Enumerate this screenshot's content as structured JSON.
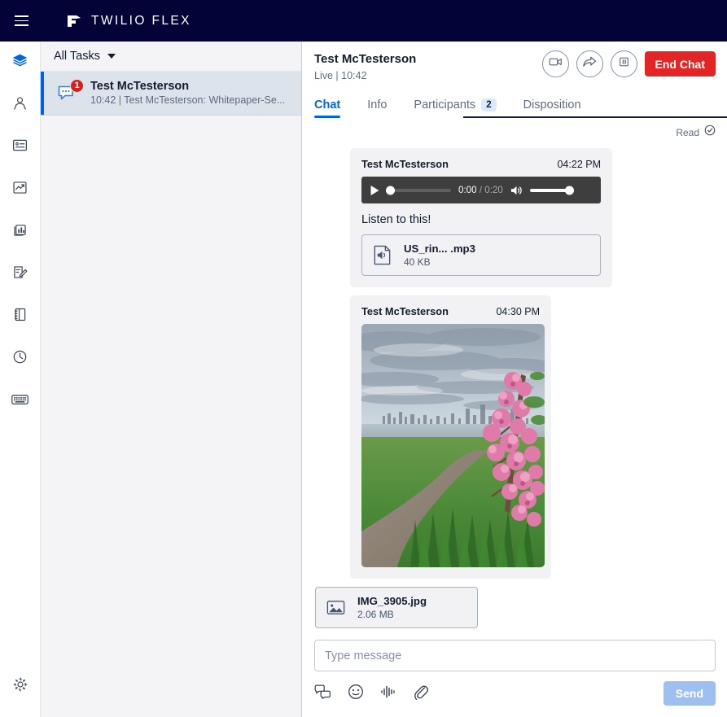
{
  "app": {
    "brand": "TWILIO FLEX",
    "menu_icon": "hamburger-icon",
    "logo_icon": "twilio-logo-icon"
  },
  "rail": {
    "items": [
      {
        "icon": "layers-icon",
        "name": "agent-desktop",
        "active": true
      },
      {
        "icon": "agents-icon",
        "name": "agents",
        "active": false
      },
      {
        "icon": "contact-list-icon",
        "name": "queues-stats",
        "active": false
      },
      {
        "icon": "trend-chart-icon",
        "name": "real-time-dashboard",
        "active": false
      },
      {
        "icon": "bar-chart-icon",
        "name": "insights-dashboards",
        "active": false
      },
      {
        "icon": "form-edit-icon",
        "name": "forms",
        "active": false
      },
      {
        "icon": "notebook-icon",
        "name": "directory",
        "active": false
      },
      {
        "icon": "clock-icon",
        "name": "history",
        "active": false
      },
      {
        "icon": "keyboard-icon",
        "name": "keyboard-shortcuts",
        "active": false
      }
    ],
    "settings_icon": "gear-icon"
  },
  "tasklist": {
    "filter_label": "All Tasks",
    "filter_caret_icon": "caret-down-icon",
    "tasks": [
      {
        "icon": "chat-bubble-icon",
        "badge": "1",
        "title": "Test McTesterson",
        "preview": "10:42 | Test McTesterson: Whitepaper-Se...",
        "selected": true
      }
    ]
  },
  "chat": {
    "contact_name": "Test McTesterson",
    "status": "Live | 10:42",
    "actions": [
      {
        "icon": "video-camera-icon",
        "name": "start-video-button"
      },
      {
        "icon": "forward-arrow-icon",
        "name": "transfer-task-button"
      },
      {
        "icon": "pause-icon",
        "name": "hold-task-button"
      }
    ],
    "end_chat_label": "End Chat",
    "tabs": [
      {
        "label": "Chat",
        "active": true,
        "badge": null
      },
      {
        "label": "Info",
        "active": false,
        "badge": null
      },
      {
        "label": "Participants",
        "active": false,
        "badge": "2"
      },
      {
        "label": "Disposition",
        "active": false,
        "badge": null
      }
    ],
    "read_receipt": {
      "label": "Read",
      "icon": "check-circle-icon"
    },
    "messages": [
      {
        "type": "audio",
        "author": "Test McTesterson",
        "time": "04:22 PM",
        "player": {
          "play_icon": "play-icon",
          "current_time": "0:00",
          "separator": "/",
          "duration": "0:20",
          "volume_icon": "volume-icon"
        },
        "text": "Listen to this!",
        "attachment": {
          "icon": "audio-file-icon",
          "name": "US_rin...  .mp3",
          "size": "40 KB"
        }
      },
      {
        "type": "image",
        "author": "Test McTesterson",
        "time": "04:30 PM",
        "attachment": {
          "icon": "image-file-icon",
          "name": "IMG_3905.jpg",
          "size": "2.06 MB"
        }
      }
    ],
    "composer": {
      "placeholder": "Type message",
      "value": "",
      "tools": [
        {
          "icon": "quick-responses-icon",
          "name": "quick-responses-button"
        },
        {
          "icon": "emoji-icon",
          "name": "emoji-picker-button"
        },
        {
          "icon": "audio-waveform-icon",
          "name": "record-audio-button"
        },
        {
          "icon": "paperclip-icon",
          "name": "attach-file-button"
        }
      ],
      "send_label": "Send"
    }
  },
  "colors": {
    "brand_navy": "#030337",
    "accent_blue": "#0263e0",
    "danger_red": "#e22525",
    "badge_red": "#d61f1f",
    "selected_task_bg": "#dde3ea",
    "bubble_bg": "#f2f2f5",
    "player_bg": "#3e3e3e",
    "send_disabled": "#9dc0f0"
  }
}
